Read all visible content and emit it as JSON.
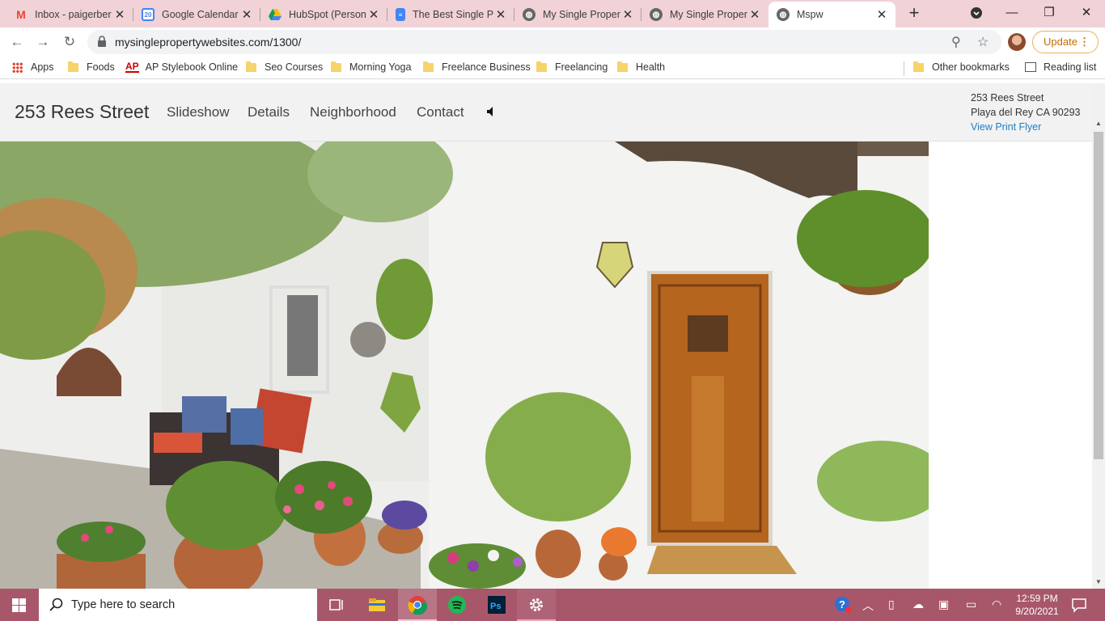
{
  "browser": {
    "tabs": [
      {
        "title": "Inbox - paigerber",
        "icon": "gmail-icon",
        "active": false
      },
      {
        "title": "Google Calendar",
        "icon": "calendar-icon",
        "active": false
      },
      {
        "title": "HubSpot (Person",
        "icon": "drive-icon",
        "active": false
      },
      {
        "title": "The Best Single P",
        "icon": "docs-icon",
        "active": false
      },
      {
        "title": "My Single Proper",
        "icon": "globe-icon",
        "active": false
      },
      {
        "title": "My Single Proper",
        "icon": "globe-icon",
        "active": false
      },
      {
        "title": "Mspw",
        "icon": "globe-icon",
        "active": true
      }
    ],
    "url": "mysinglepropertywebsites.com/1300/",
    "update_label": "Update",
    "calendar_badge": "20"
  },
  "bookmarks": {
    "apps": "Apps",
    "items": [
      "Foods",
      "AP Stylebook Online",
      "Seo Courses",
      "Morning Yoga",
      "Freelance Business",
      "Freelancing",
      "Health"
    ],
    "ap_prefix": "AP",
    "other": "Other bookmarks",
    "reading_list": "Reading list"
  },
  "site": {
    "title": "253 Rees Street",
    "nav": [
      "Slideshow",
      "Details",
      "Neighborhood",
      "Contact"
    ],
    "address_line1": "253 Rees Street",
    "address_line2": "Playa del Rey CA 90293",
    "flyer_link": "View Print Flyer"
  },
  "taskbar": {
    "search_placeholder": "Type here to search",
    "time": "12:59 PM",
    "date": "9/20/2021"
  },
  "colors": {
    "tabstrip": "#f1d2d7",
    "taskbar": "#a8576b",
    "link": "#1f7fc4",
    "update_accent": "#c26c00"
  }
}
